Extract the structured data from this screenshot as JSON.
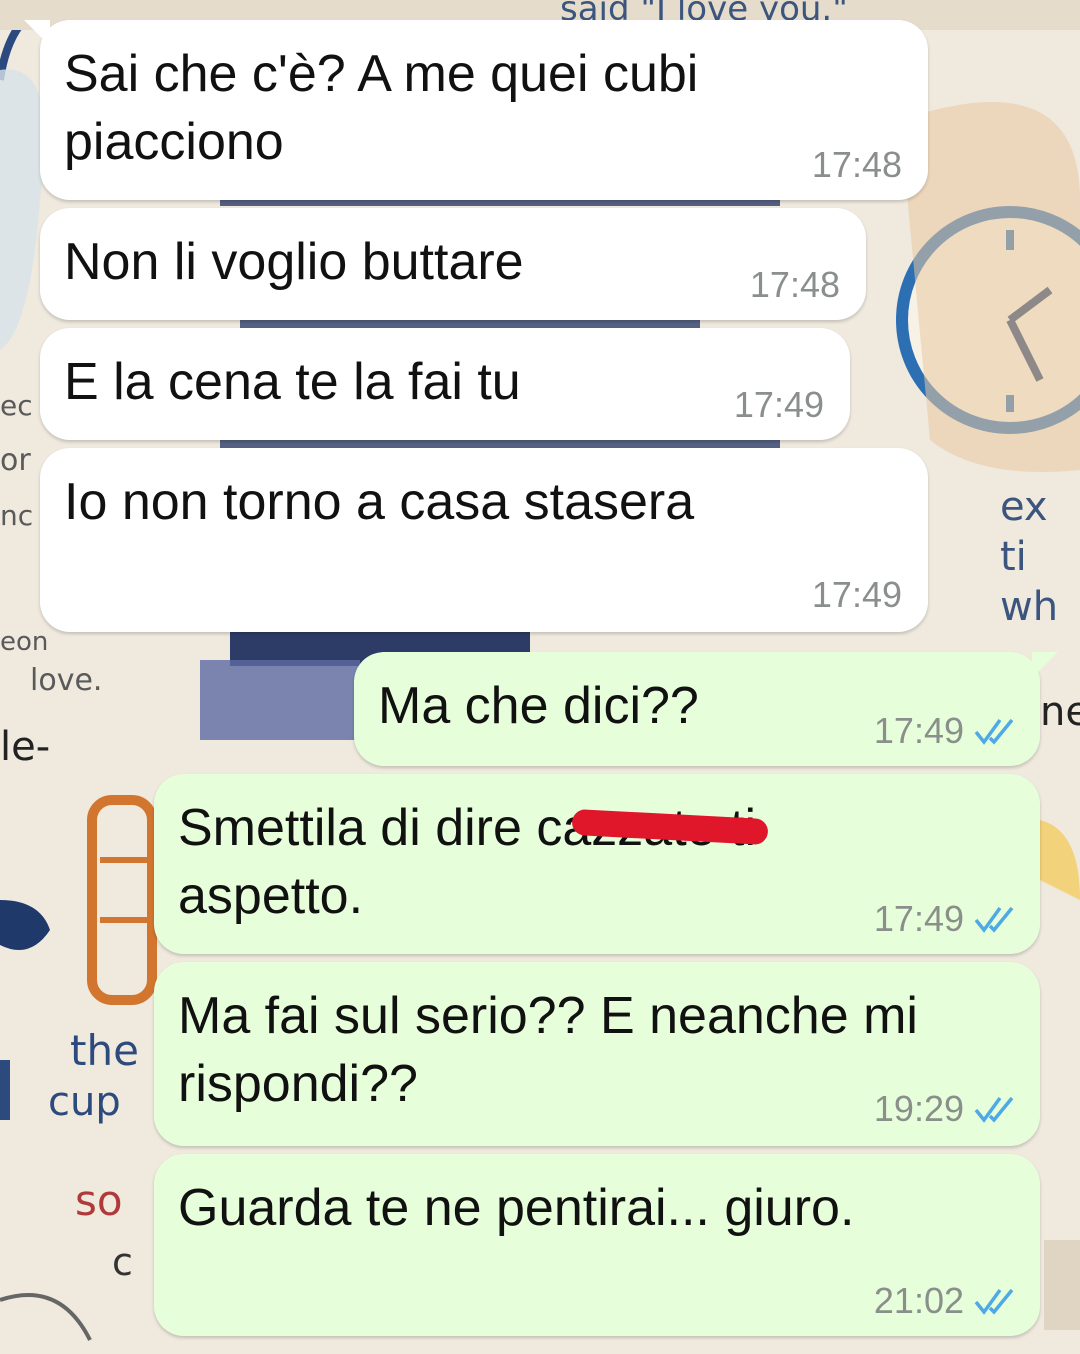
{
  "wallpaper": {
    "doodle_top": "said \"I love you.\"",
    "doodle_left": [
      "love.",
      "le-",
      "the",
      "cup",
      "so",
      "c"
    ],
    "doodle_right": [
      "ex",
      "ti",
      "wh",
      "ne"
    ]
  },
  "messages": [
    {
      "direction": "incoming",
      "text": "Sai che c'è? A me quei cubi piacciono",
      "time": "17:48"
    },
    {
      "direction": "incoming",
      "text": "Non li voglio buttare",
      "time": "17:48"
    },
    {
      "direction": "incoming",
      "text": "E la cena te la fai tu",
      "time": "17:49"
    },
    {
      "direction": "incoming",
      "text": "Io non torno a casa stasera",
      "time": "17:49"
    },
    {
      "direction": "outgoing",
      "text": "Ma che dici??",
      "time": "17:49",
      "status": "read"
    },
    {
      "direction": "outgoing",
      "text": "Smettila di dire cazzate ti aspetto.",
      "time": "17:49",
      "status": "read",
      "redacted_word": "cazzate"
    },
    {
      "direction": "outgoing",
      "text": "Ma fai sul serio?? E neanche mi rispondi??",
      "time": "19:29",
      "status": "read"
    },
    {
      "direction": "outgoing",
      "text": "Guarda te ne pentirai... giuro.",
      "time": "21:02",
      "status": "read"
    }
  ],
  "colors": {
    "incoming_bubble": "#ffffff",
    "outgoing_bubble": "#e6ffda",
    "read_ticks": "#4fa9e6",
    "redaction": "#e0162b"
  },
  "icons": {
    "read_receipt": "double-check-icon"
  }
}
